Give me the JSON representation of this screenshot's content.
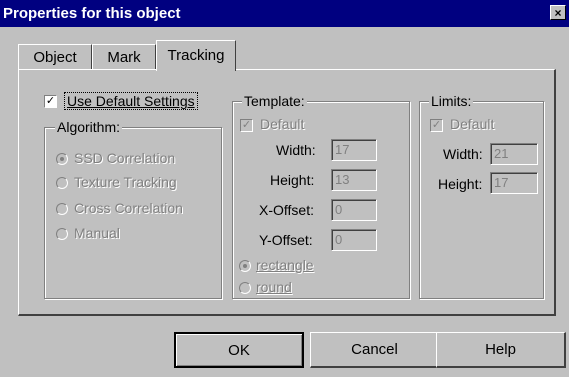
{
  "window": {
    "title": "Properties for this object",
    "close_glyph": "×"
  },
  "tabs": [
    {
      "label": "Object"
    },
    {
      "label": "Mark"
    },
    {
      "label": "Tracking",
      "active": true
    }
  ],
  "use_default": {
    "label": "Use Default Settings",
    "checked": true
  },
  "algorithm": {
    "legend": "Algorithm:",
    "options": [
      {
        "label": "SSD Correlation",
        "selected": true
      },
      {
        "label": "Texture Tracking",
        "selected": false
      },
      {
        "label": "Cross Correlation",
        "selected": false
      },
      {
        "label": "Manual",
        "selected": false
      }
    ]
  },
  "template": {
    "legend": "Template:",
    "default_label": "Default",
    "width_label": "Width:",
    "width_value": "17",
    "height_label": "Height:",
    "height_value": "13",
    "xoffset_label": "X-Offset:",
    "xoffset_value": "0",
    "yoffset_label": "Y-Offset:",
    "yoffset_value": "0",
    "shape_options": [
      {
        "label": "rectangle",
        "selected": true
      },
      {
        "label": "round",
        "selected": false
      }
    ]
  },
  "limits": {
    "legend": "Limits:",
    "default_label": "Default",
    "width_label": "Width:",
    "width_value": "21",
    "height_label": "Height:",
    "height_value": "17"
  },
  "buttons": {
    "ok": "OK",
    "cancel": "Cancel",
    "help": "Help"
  },
  "colors": {
    "titlebar": "#000080",
    "face": "#c0c0c0",
    "disabled": "#808080"
  }
}
